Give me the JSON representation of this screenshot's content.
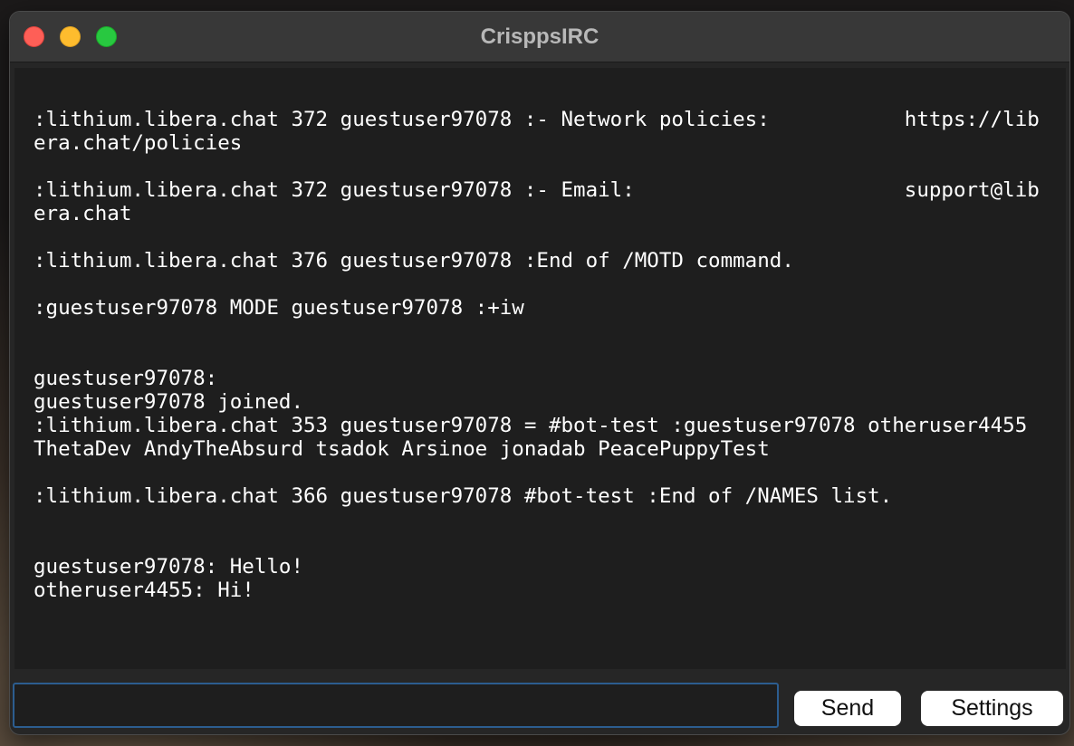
{
  "window": {
    "title": "CrisppsIRC"
  },
  "log": {
    "lines": [
      ":lithium.libera.chat 372 guestuser97078 :- Network policies:           https://libera.chat/policies",
      "",
      ":lithium.libera.chat 372 guestuser97078 :- Email:                      support@libera.chat",
      "",
      ":lithium.libera.chat 376 guestuser97078 :End of /MOTD command.",
      "",
      ":guestuser97078 MODE guestuser97078 :+iw",
      "",
      "",
      "guestuser97078:",
      "guestuser97078 joined.",
      ":lithium.libera.chat 353 guestuser97078 = #bot-test :guestuser97078 otheruser4455 ThetaDev AndyTheAbsurd tsadok Arsinoe jonadab PeacePuppyTest",
      "",
      ":lithium.libera.chat 366 guestuser97078 #bot-test :End of /NAMES list.",
      "",
      "",
      "guestuser97078: Hello!",
      "otheruser4455: Hi!"
    ]
  },
  "input": {
    "value": "",
    "placeholder": ""
  },
  "buttons": {
    "send_label": "Send",
    "settings_label": "Settings"
  },
  "colors": {
    "titlebar": "#383838",
    "log_background": "#1e1e1e",
    "input_border": "#2c5d8f",
    "close": "#fe5f57",
    "minimize": "#febc2e",
    "maximize": "#28c840"
  }
}
